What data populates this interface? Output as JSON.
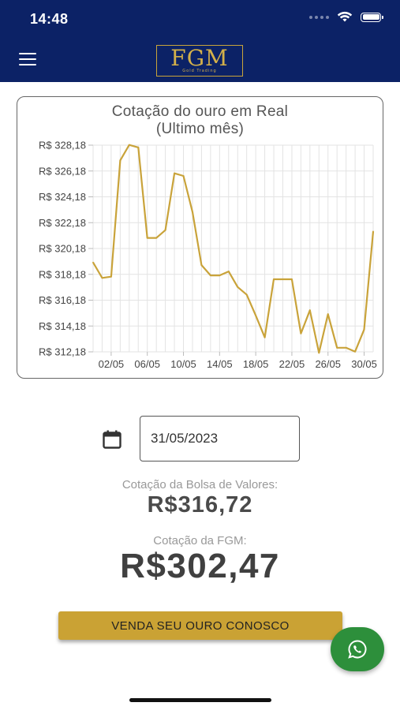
{
  "status_bar": {
    "time": "14:48"
  },
  "header": {
    "logo_text": "FGM",
    "logo_subtitle": "Gold Trading",
    "menu_icon": "hamburger-menu-icon"
  },
  "chart_data": {
    "type": "line",
    "title": "Cotação do ouro em Real",
    "subtitle": "(Ultimo mês)",
    "ylim": [
      312.18,
      328.18
    ],
    "y_ticks": [
      "R$ 328,18",
      "R$ 326,18",
      "R$ 324,18",
      "R$ 322,18",
      "R$ 320,18",
      "R$ 318,18",
      "R$ 316,18",
      "R$ 314,18",
      "R$ 312,18"
    ],
    "y_tick_values": [
      328.18,
      326.18,
      324.18,
      322.18,
      320.18,
      318.18,
      316.18,
      314.18,
      312.18
    ],
    "x_ticks": [
      "02/05",
      "06/05",
      "10/05",
      "14/05",
      "18/05",
      "22/05",
      "26/05",
      "30/05"
    ],
    "x_tick_days": [
      2,
      6,
      10,
      14,
      18,
      22,
      26,
      30
    ],
    "xlim": [
      0,
      31
    ],
    "grid": true,
    "line_color": "#c9a33a",
    "series": [
      {
        "x": [
          0,
          1,
          2,
          3,
          4,
          5,
          6,
          7,
          8,
          9,
          10,
          11,
          12,
          13,
          14,
          15,
          16,
          17,
          18,
          19,
          20,
          21,
          22,
          23,
          24,
          25,
          26,
          27,
          28,
          29,
          30,
          31
        ],
        "values": [
          319.1,
          317.9,
          318.0,
          327.0,
          328.2,
          328.0,
          321.0,
          321.0,
          321.6,
          326.0,
          325.8,
          323.0,
          318.9,
          318.1,
          318.1,
          318.4,
          317.2,
          316.6,
          315.0,
          313.3,
          317.8,
          317.8,
          317.8,
          313.6,
          315.4,
          312.1,
          315.1,
          312.5,
          312.5,
          312.2,
          313.9,
          321.5
        ]
      }
    ]
  },
  "date_picker": {
    "value": "31/05/2023",
    "icon": "calendar-icon"
  },
  "quotes": {
    "bolsa_label": "Cotação da Bolsa de Valores:",
    "bolsa_value": "R$316,72",
    "fgm_label": "Cotação da FGM:",
    "fgm_value": "R$302,47"
  },
  "actions": {
    "sell_label": "VENDA SEU OURO CONOSCO",
    "whatsapp_icon": "whatsapp-icon"
  },
  "colors": {
    "header_bg": "#0c2266",
    "gold": "#caa234",
    "whatsapp_green": "#2d8f3b"
  }
}
